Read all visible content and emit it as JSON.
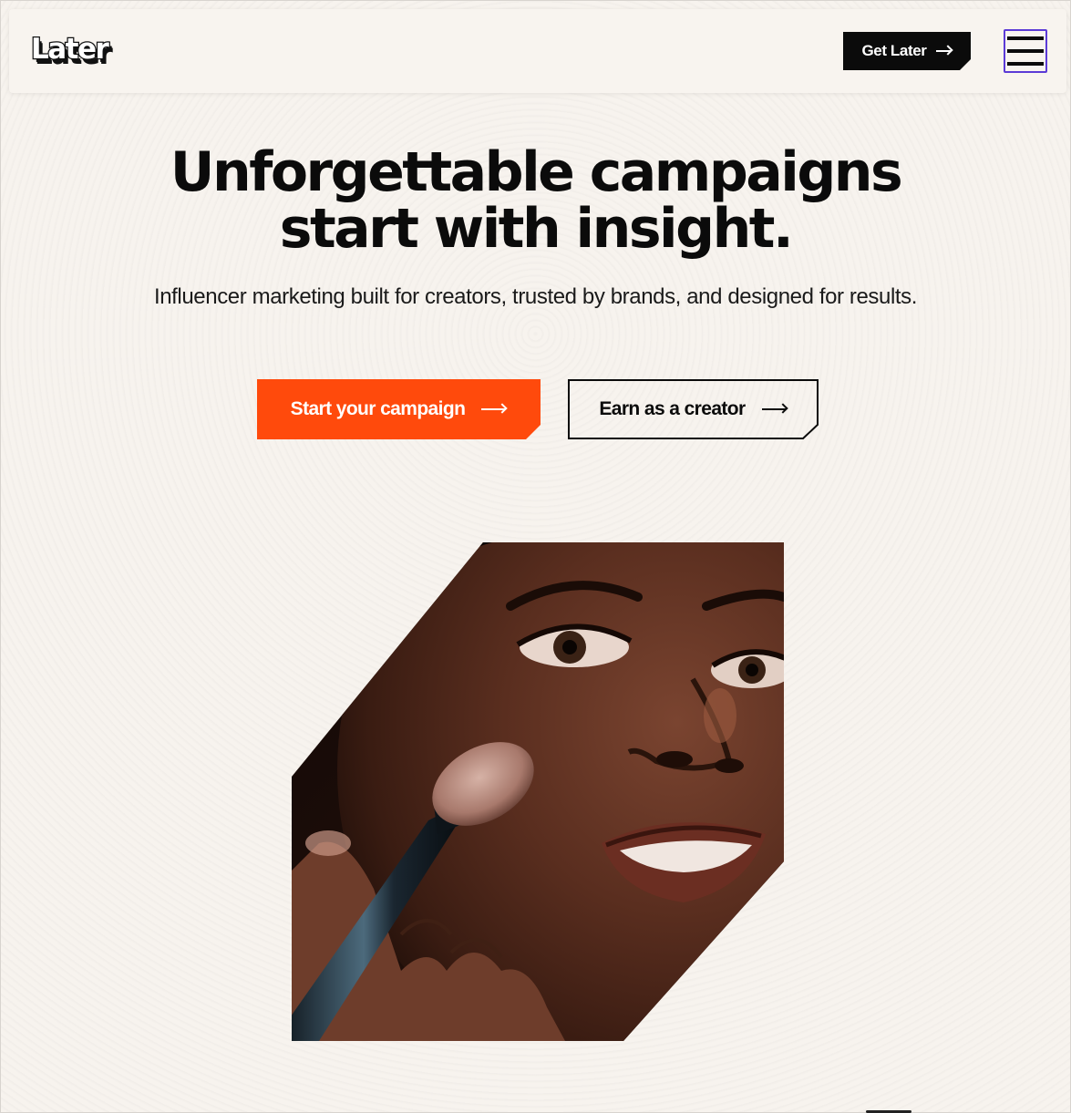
{
  "header": {
    "logo_text": "Later",
    "get_later_label": "Get Later",
    "menu_icon": "hamburger-menu-icon"
  },
  "hero": {
    "title_line1": "Unforgettable campaigns",
    "title_line2": "start with insight.",
    "subtitle": "Influencer marketing built for creators, trusted by brands, and designed for results.",
    "cta_primary_label": "Start your campaign",
    "cta_secondary_label": "Earn as a creator",
    "image_alt": "Person applying makeup with a brush"
  },
  "colors": {
    "background": "#f7f3ee",
    "accent_orange": "#ff4a0c",
    "black": "#0b0b0b",
    "focus_outline": "#5b3bd6"
  },
  "icons": {
    "arrow": "arrow-right-icon"
  }
}
